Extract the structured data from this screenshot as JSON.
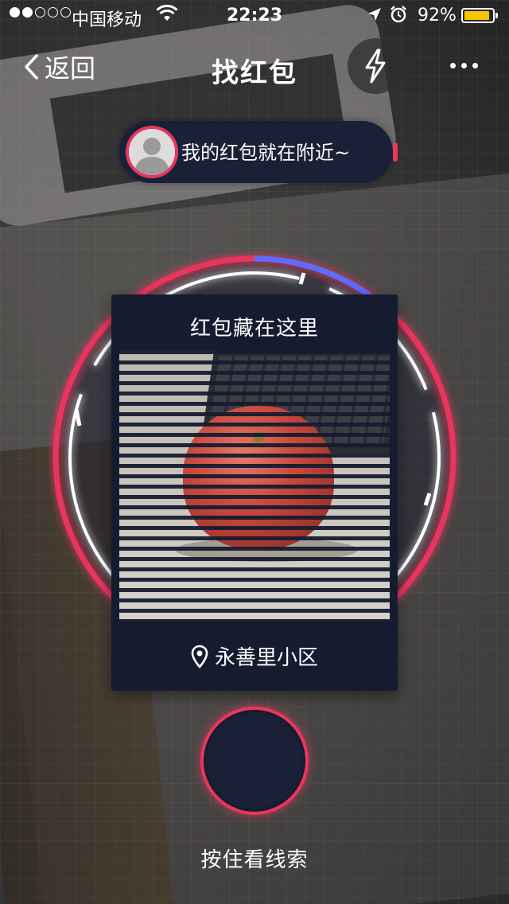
{
  "status_bar": {
    "carrier": "中国移动",
    "time": "22:23",
    "battery_percent": "92%",
    "battery_level": 0.92,
    "signal_bars_filled": 2,
    "signal_bars_total": 5,
    "icons": [
      "wifi-icon",
      "location-arrow-icon",
      "alarm-icon",
      "battery-icon"
    ]
  },
  "nav": {
    "back_label": "返回",
    "title": "找红包",
    "flash_icon": "lightning-icon",
    "more_icon": "more-dots-icon"
  },
  "hint": {
    "text": "我的红包就在附近~",
    "avatar_icon": "default-user-avatar"
  },
  "card": {
    "title": "红包藏在这里",
    "location": "永善里小区",
    "location_icon": "map-pin-icon"
  },
  "hold_button": {
    "label": "按住看线索"
  },
  "colors": {
    "accent": "#e8365d",
    "panel": "#161c30",
    "battery": "#f7c500"
  }
}
